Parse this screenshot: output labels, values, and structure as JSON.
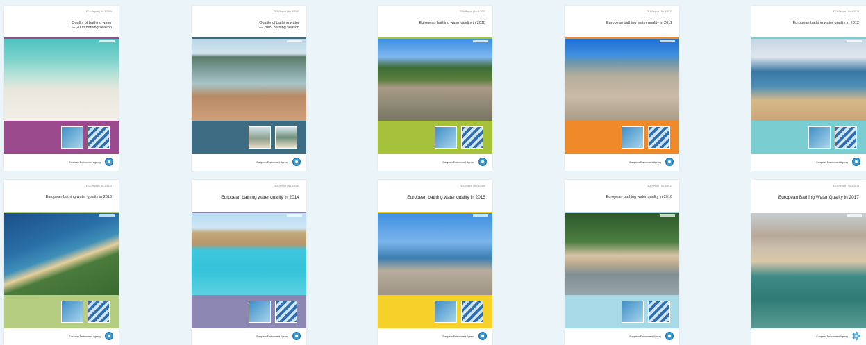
{
  "covers": [
    {
      "report": "EEA Report | No 3/2009",
      "title": "Quality of bathing water\n— 2008 bathing season",
      "agency": "European Environment Agency",
      "band": "#9b4a8e",
      "rule": "#9b4a8e"
    },
    {
      "report": "EEA Report | No 3/2010",
      "title": "Quality of bathing water\n— 2009 bathing season",
      "agency": "European Environment Agency",
      "band": "#3d6b82",
      "rule": "#3d6b82"
    },
    {
      "report": "EEA Report | No 1/2011",
      "title": "European bathing water quality in 2010",
      "agency": "European Environment Agency",
      "band": "#a5c23a",
      "rule": "#a5c23a"
    },
    {
      "report": "EEA Report | No 3/2012",
      "title": "European bathing water quality in 2011",
      "agency": "European Environment Agency",
      "band": "#f0892a",
      "rule": "#f0892a"
    },
    {
      "report": "EEA Report | No 4/2013",
      "title": "European bathing water quality in 2012",
      "agency": "European Environment Agency",
      "band": "#7acdd0",
      "rule": "#7acdd0"
    },
    {
      "report": "EEA Report | No 1/2014",
      "title": "European bathing water quality in 2013",
      "agency": "European Environment Agency",
      "band": "#b4cd80",
      "rule": "#b4cd80"
    },
    {
      "report": "EEA Report | No 1/2015",
      "title": "European bathing water quality in 2014",
      "agency": "European Environment Agency",
      "band": "#8c87b2",
      "rule": "#8c87b2"
    },
    {
      "report": "EEA Report | No 9/2016",
      "title": "European bathing water quality in 2015",
      "agency": "European Environment Agency",
      "band": "#f6d12a",
      "rule": "#f6d12a"
    },
    {
      "report": "EEA Report | No 5/2017",
      "title": "European bathing water quality in 2016",
      "agency": "European Environment Agency",
      "band": "#a7d9e6",
      "rule": "#a7d9e6"
    },
    {
      "report": "EEA Report | No 2/2018",
      "title": "European Bathing Water Quality in 2017",
      "agency": "European Environment Agency",
      "band": "#ffffff",
      "rule": "#ffffff"
    }
  ]
}
